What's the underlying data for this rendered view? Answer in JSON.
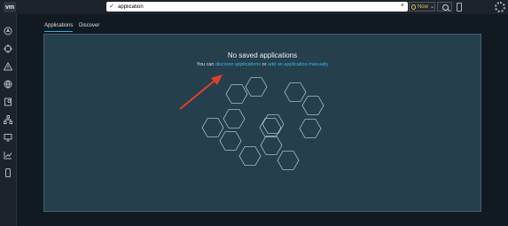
{
  "topbar": {
    "logo": "vm",
    "search_value": "application",
    "time_label": "Now",
    "icons": [
      "search-icon",
      "clear-icon",
      "clock-icon",
      "chevron-down-icon",
      "phone-icon",
      "gear-icon"
    ]
  },
  "sidebar": {
    "icons": [
      "home-icon",
      "troubleshoot-icon",
      "alert-icon",
      "network-icon",
      "plan-icon",
      "topology-icon",
      "monitor-icon",
      "reports-icon",
      "device-icon"
    ]
  },
  "tabs": [
    {
      "label": "Applications",
      "active": true
    },
    {
      "label": "Discover",
      "active": false
    }
  ],
  "empty_state": {
    "title": "No saved applications",
    "prefix": "You can",
    "discover_link": "discover applications",
    "or_text": "or",
    "add_link": "add an application manually"
  },
  "colors": {
    "panel_bg": "#263f4c",
    "link": "#3ab7f0",
    "arrow": "#e0402a",
    "active_tab": "#2ab2e6"
  }
}
